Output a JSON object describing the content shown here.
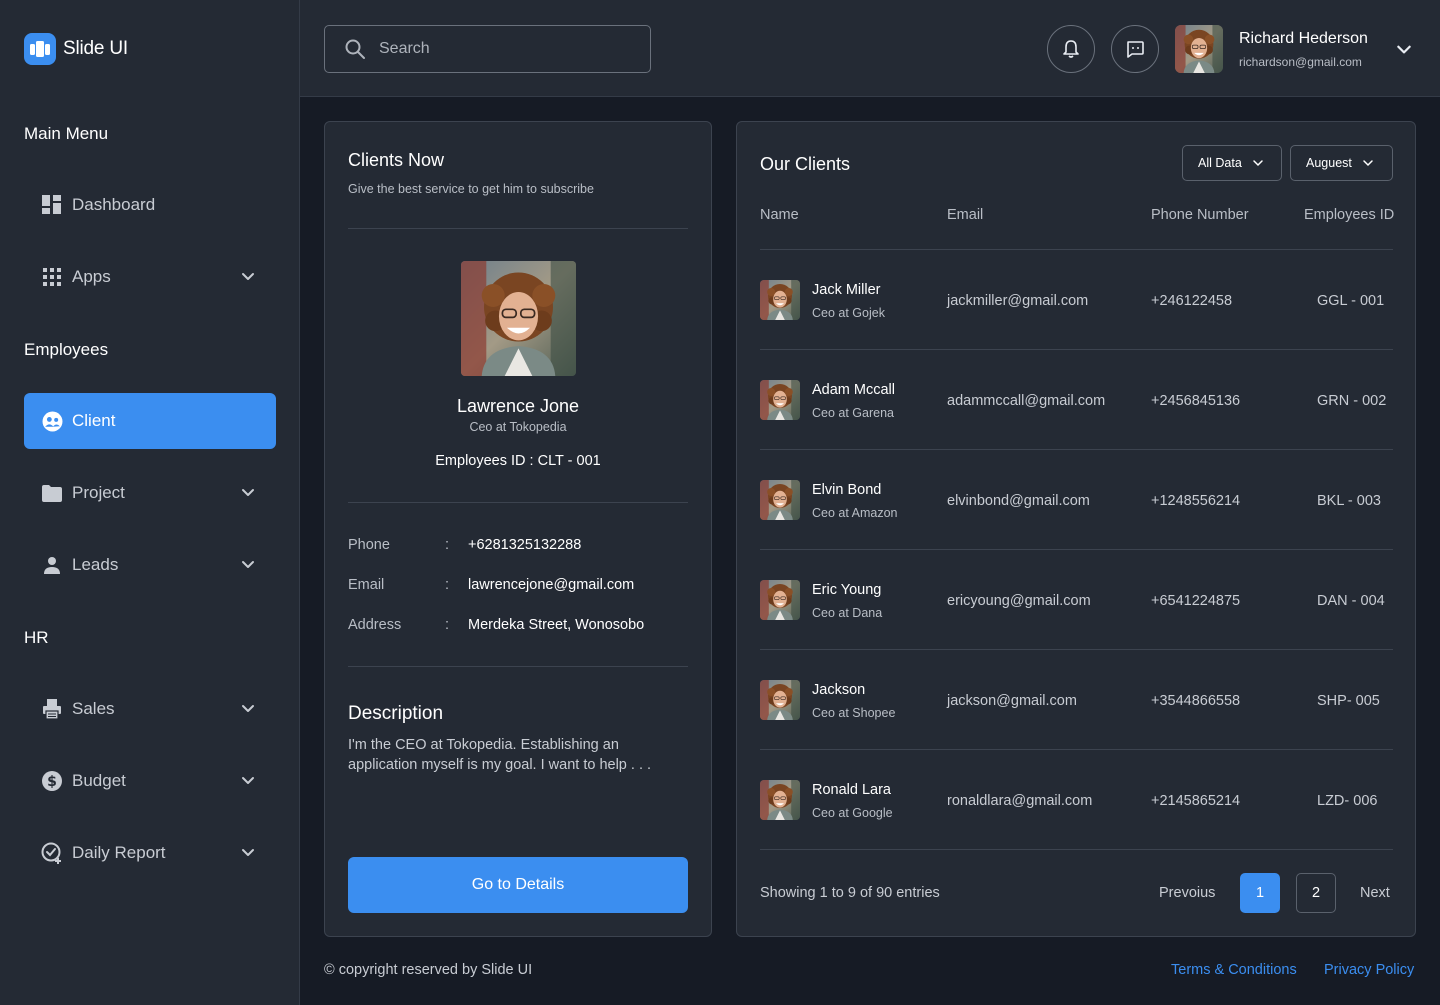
{
  "brand": {
    "name": "Slide UI",
    "accent": "#3b8ef0"
  },
  "sidebar": {
    "sections": {
      "main_menu": "Main Menu",
      "employees": "Employees",
      "hr": "HR"
    },
    "items": [
      {
        "label": "Dashboard",
        "icon": "dashboard-icon"
      },
      {
        "label": "Apps",
        "icon": "apps-grid-icon"
      },
      {
        "label": "Client",
        "icon": "client-icon",
        "active": true
      },
      {
        "label": "Project",
        "icon": "folder-icon"
      },
      {
        "label": "Leads",
        "icon": "person-icon"
      },
      {
        "label": "Sales",
        "icon": "printer-icon"
      },
      {
        "label": "Budget",
        "icon": "dollar-icon"
      },
      {
        "label": "Daily Report",
        "icon": "check-report-icon"
      }
    ]
  },
  "header": {
    "search_placeholder": "Search",
    "user": {
      "name": "Richard Hederson",
      "email": "richardson@gmail.com"
    }
  },
  "client_card": {
    "title": "Clients Now",
    "subtitle": "Give the best service to get him to subscribe",
    "name": "Lawrence Jone",
    "role": "Ceo at Tokopedia",
    "employee_id": "Employees ID : CLT - 001",
    "info": [
      {
        "label": "Phone",
        "sep": ":",
        "value": "+6281325132288"
      },
      {
        "label": "Email",
        "sep": ":",
        "value": "lawrencejone@gmail.com"
      },
      {
        "label": "Address",
        "sep": ":",
        "value": "Merdeka Street, Wonosobo"
      }
    ],
    "description_title": "Description",
    "description": "I'm the CEO at Tokopedia. Establishing an application myself is my goal. I want to help  . . .",
    "button": "Go to Details"
  },
  "clients_table": {
    "title": "Our Clients",
    "filter_all": "All Data",
    "filter_month": "Auguest",
    "columns": [
      "Name",
      "Email",
      "Phone Number",
      "Employees ID"
    ],
    "rows": [
      {
        "name": "Jack Miller",
        "role": "Ceo at Gojek",
        "email": "jackmiller@gmail.com",
        "phone": "+246122458",
        "id": "GGL - 001"
      },
      {
        "name": "Adam Mccall",
        "role": "Ceo at Garena",
        "email": "adammccall@gmail.com",
        "phone": "+2456845136",
        "id": "GRN - 002"
      },
      {
        "name": "Elvin Bond",
        "role": "Ceo at Amazon",
        "email": "elvinbond@gmail.com",
        "phone": "+1248556214",
        "id": "BKL - 003"
      },
      {
        "name": "Eric Young",
        "role": "Ceo at Dana",
        "email": "ericyoung@gmail.com",
        "phone": "+6541224875",
        "id": "DAN - 004"
      },
      {
        "name": "Jackson",
        "role": "Ceo at Shopee",
        "email": "jackson@gmail.com",
        "phone": "+3544866558",
        "id": "SHP- 005"
      },
      {
        "name": "Ronald Lara",
        "role": "Ceo at Google",
        "email": "ronaldlara@gmail.com",
        "phone": "+2145865214",
        "id": "LZD- 006"
      }
    ],
    "showing": "Showing 1 to 9 of 90 entries",
    "prev": "Prevoius",
    "pages": [
      "1",
      "2"
    ],
    "current_page": "1",
    "next": "Next"
  },
  "footer": {
    "copyright": "© copyright reserved by Slide UI",
    "terms": "Terms & Conditions",
    "privacy": "Privacy Policy"
  }
}
